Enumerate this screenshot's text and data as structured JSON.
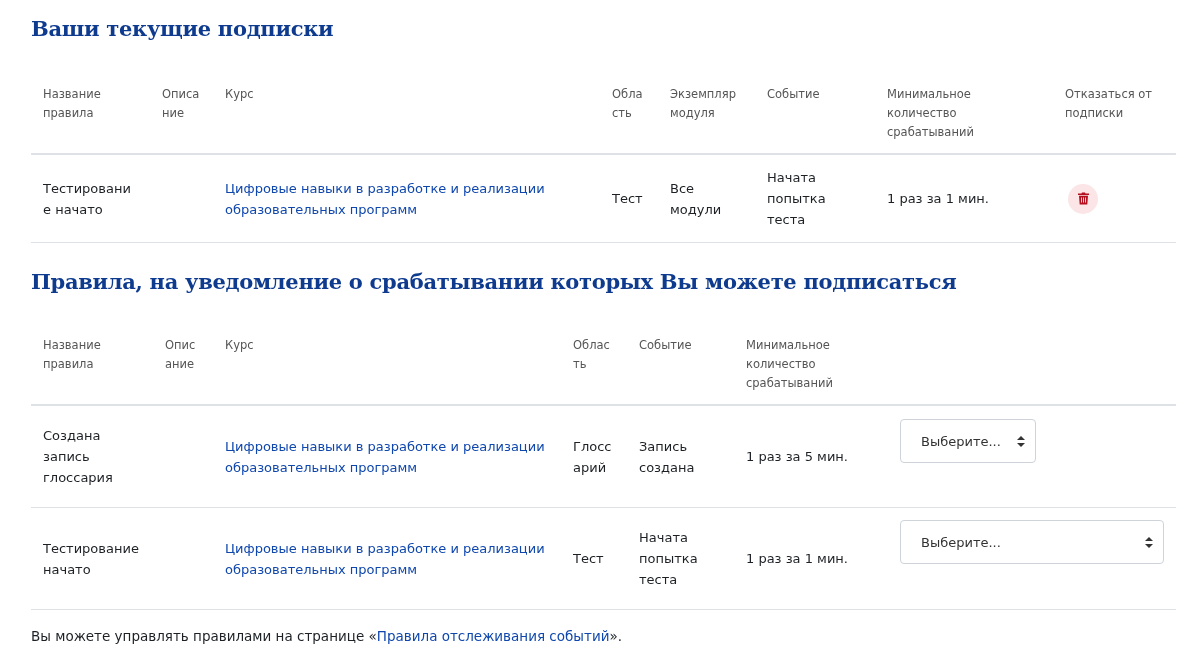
{
  "current": {
    "title": "Ваши текущие подписки",
    "columns": [
      "Название правила",
      "Описание",
      "Курс",
      "Область",
      "Экземпляр модуля",
      "Событие",
      "Минимальное количество срабатываний",
      "Отказаться от подписки"
    ],
    "rows": [
      {
        "name": "Тестирование начато",
        "course": "Цифровые навыки в разработке и реализации образовательных программ",
        "area": "Тест",
        "instance": "Все модули",
        "event": "Начата попытка теста",
        "frequency": "1 раз за 1 мин."
      }
    ]
  },
  "available": {
    "title": "Правила, на уведомление о срабатывании которых Вы можете подписаться",
    "columns": [
      "Название правила",
      "Описание",
      "Курс",
      "Область",
      "Событие",
      "Минимальное количество срабатываний"
    ],
    "rows": [
      {
        "name": "Создана запись глоссария",
        "course": "Цифровые навыки в разработке и реализации образовательных программ",
        "area": "Глоссарий",
        "event": "Запись создана",
        "frequency": "1 раз за 5 мин.",
        "select": {
          "value": "Выберите...",
          "kind": "compact"
        }
      },
      {
        "name": "Тестирование начато",
        "course": "Цифровые навыки в разработке и реализации образовательных программ",
        "area": "Тест",
        "event": "Начата попытка теста",
        "frequency": "1 раз за 1 мин.",
        "select": {
          "value": "Выберите...",
          "kind": "full"
        }
      }
    ]
  },
  "footer": {
    "text_before": "Вы можете управлять правилами на странице «",
    "link": "Правила отслеживания событий",
    "text_after": "»."
  }
}
